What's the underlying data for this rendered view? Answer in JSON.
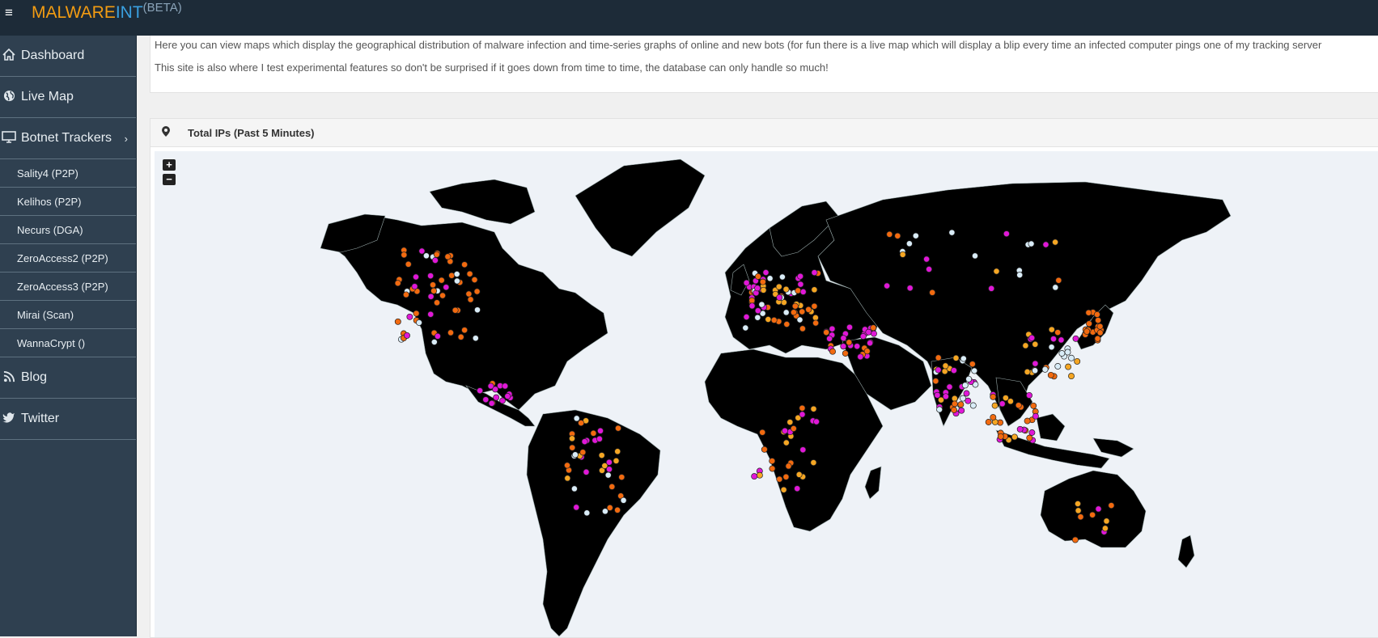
{
  "app": {
    "brand_main": "MALWARE",
    "brand_accent": "INT",
    "brand_badge": "(BETA)",
    "menu_icon": "hamburger-icon"
  },
  "sidebar": {
    "items": [
      {
        "label": "Dashboard",
        "icon": "home-icon"
      },
      {
        "label": "Live Map",
        "icon": "globe-icon"
      },
      {
        "label": "Botnet Trackers",
        "icon": "monitor-icon"
      }
    ],
    "trackers": [
      {
        "label": "Sality4 (P2P)"
      },
      {
        "label": "Kelihos (P2P)"
      },
      {
        "label": "Necurs (DGA)"
      },
      {
        "label": "ZeroAccess2 (P2P)"
      },
      {
        "label": "ZeroAccess3 (P2P)"
      },
      {
        "label": "Mirai (Scan)"
      },
      {
        "label": "WannaCrypt ()"
      }
    ],
    "bottom_items": [
      {
        "label": "Blog",
        "icon": "rss-icon"
      },
      {
        "label": "Twitter",
        "icon": "twitter-icon"
      }
    ]
  },
  "intro": {
    "line1": "Here you can view maps which display the geographical distribution of malware infection and time-series graphs of online and new bots (for fun there is a live map which will display a blip every time an infected computer pings one of my tracking server",
    "line2": "This site is also where I test experimental features so don't be surprised if it goes down from time to time, the database can only handle so much!"
  },
  "panel": {
    "title": "Total IPs (Past 5 Minutes)",
    "icon": "map-pin-icon",
    "zoom_in": "+",
    "zoom_out": "−"
  },
  "colors": {
    "topbar": "#1d2b38",
    "sidebar": "#2f4050",
    "dot_orange": "#f26a0f",
    "dot_magenta": "#e017d7",
    "dot_gold": "#f5a623",
    "dot_light": "#d9ecf7",
    "land": "#000000",
    "ocean": "#eef2f7"
  }
}
